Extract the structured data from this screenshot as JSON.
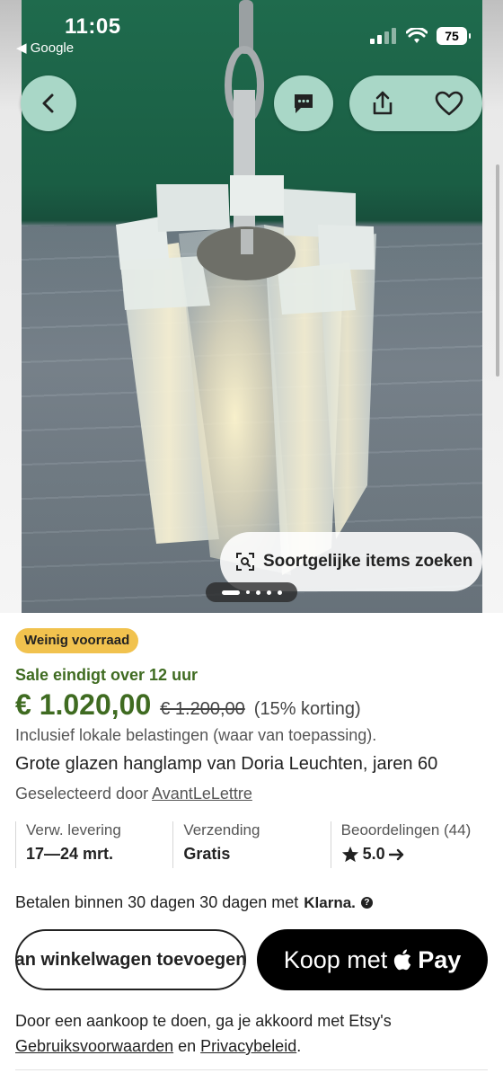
{
  "status_bar": {
    "time": "11:05",
    "back_label": "Google",
    "battery": "75"
  },
  "hero": {
    "similar_items_label": "Soortgelijke items zoeken",
    "carousel": {
      "count": 5,
      "active_index": 0
    }
  },
  "toolbar": {
    "back_icon": "chevron-left-icon",
    "message_icon": "message-icon",
    "share_icon": "share-icon",
    "favorite_icon": "heart-icon"
  },
  "product": {
    "stock_badge": "Weinig voorraad",
    "sale_ends": "Sale eindigt over 12 uur",
    "price_now": "€ 1.020,00",
    "price_old": "€ 1.200,00",
    "discount": "(15% korting)",
    "tax_note": "Inclusief lokale belastingen (waar van toepassing).",
    "title": "Grote glazen hanglamp van Doria Leuchten, jaren 60",
    "selected_by_prefix": "Geselecteerd door",
    "selected_by_shop": "AvantLeLettre"
  },
  "info": {
    "delivery_label": "Verw. levering",
    "delivery_value": "17—24 mrt.",
    "shipping_label": "Verzending",
    "shipping_value": "Gratis",
    "reviews_label": "Beoordelingen (44)",
    "reviews_value": "5.0",
    "rating": 5.0
  },
  "payment": {
    "klarna_text": "Betalen binnen 30 dagen 30 dagen met",
    "klarna_brand": "Klarna.",
    "help_glyph": "?"
  },
  "buttons": {
    "add_to_cart": "an winkelwagen toevoegen",
    "buy_prefix": "Koop met",
    "buy_pay": "Pay"
  },
  "terms": {
    "text": "Door een aankoop te doen, ga je akkoord met Etsy's",
    "terms_link": "Gebruiksvoorwaarden",
    "and": "en",
    "privacy_link": "Privacybeleid",
    "end": "."
  },
  "colors": {
    "sale_green": "#3f6b21",
    "badge_yellow": "#f1c24e",
    "fab_mint": "#a9d7c7"
  }
}
